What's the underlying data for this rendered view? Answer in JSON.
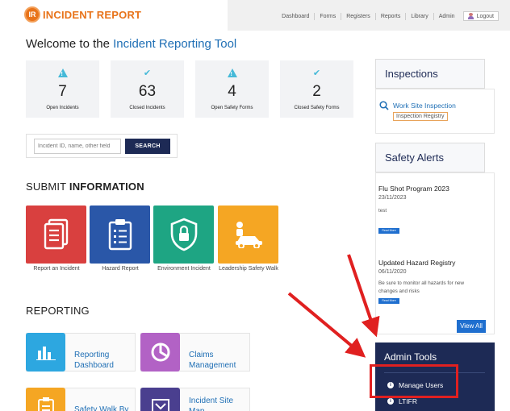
{
  "header": {
    "logo_badge": "IR",
    "logo_text": "INCIDENT REPORT",
    "nav": [
      "Dashboard",
      "Forms",
      "Registers",
      "Reports",
      "Library",
      "Admin"
    ],
    "logout": "Logout"
  },
  "welcome": {
    "prefix": "Welcome to the ",
    "accent": "Incident Reporting Tool"
  },
  "stats": [
    {
      "icon": "warning-icon",
      "value": "7",
      "label": "Open Incidents"
    },
    {
      "icon": "check-icon",
      "value": "63",
      "label": "Closed Incidents"
    },
    {
      "icon": "warning-icon",
      "value": "4",
      "label": "Open Safety Forms"
    },
    {
      "icon": "check-icon",
      "value": "2",
      "label": "Closed Safety Forms"
    }
  ],
  "search": {
    "placeholder": "Incident ID, name, other field",
    "button": "SEARCH"
  },
  "submit": {
    "title_plain": "SUBMIT ",
    "title_bold": "INFORMATION",
    "tiles": [
      {
        "label": "Report an Incident",
        "color": "#d9403f",
        "icon": "documents-icon"
      },
      {
        "label": "Hazard Report",
        "color": "#2a57a8",
        "icon": "clipboard-icon"
      },
      {
        "label": "Environment Incident",
        "color": "#1ea583",
        "icon": "shield-lock-icon"
      },
      {
        "label": "Leadership Safety Walk",
        "color": "#f5a623",
        "icon": "vehicle-icon"
      }
    ]
  },
  "reporting": {
    "title": "REPORTING",
    "cards": [
      {
        "label": "Reporting Dashboard",
        "color": "#2da7e0",
        "icon": "bar-chart-icon"
      },
      {
        "label": "Claims Management",
        "color": "#b262c5",
        "icon": "pie-chart-icon"
      },
      {
        "label": "Safety Walk By",
        "color": "#f5a623",
        "icon": "checklist-icon"
      },
      {
        "label": "Incident Site Map",
        "color": "#4a3f8f",
        "icon": "map-icon"
      }
    ]
  },
  "inspections": {
    "title": "Inspections",
    "link": "Work Site Inspection",
    "registry": "Inspection Registry"
  },
  "safety_alerts": {
    "title": "Safety Alerts",
    "items": [
      {
        "title": "Flu Shot Program 2023",
        "date": "23/11/2023",
        "text": "test",
        "read_more": "Read More"
      },
      {
        "title": "Updated Hazard Registry",
        "date": "06/11/2020",
        "text": "Be sure to monitor all hazards for new changes and risks",
        "read_more": "Read More"
      }
    ],
    "view_all": "View All"
  },
  "admin_tools": {
    "title": "Admin Tools",
    "items": [
      "Manage Users",
      "LTIFR"
    ]
  },
  "colors": {
    "navy": "#1d2a55",
    "accent_blue": "#1f6fb5",
    "logo_orange": "#e8731a",
    "annotation_red": "#e02020"
  }
}
